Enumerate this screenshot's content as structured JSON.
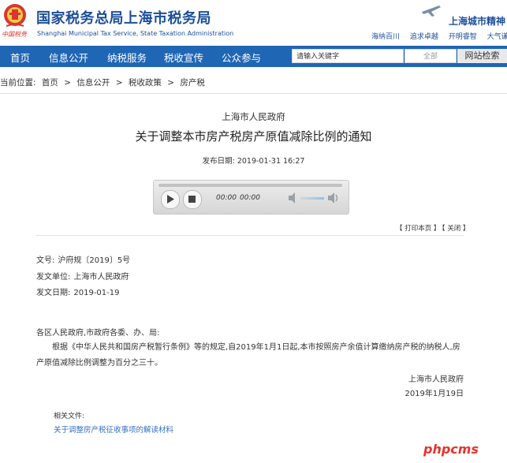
{
  "header": {
    "emblem_text": "中国税务",
    "title_cn": "国家税务总局上海市税务局",
    "title_en": "Shanghai Municipal Tax Service, State Taxation Administration",
    "city_spirit": "上海城市精神",
    "mottos": [
      "海纳百川",
      "追求卓越",
      "开明睿智",
      "大气谦和"
    ]
  },
  "nav": {
    "items": [
      "首页",
      "信息公开",
      "纳税服务",
      "税收宣传",
      "公众参与"
    ]
  },
  "search": {
    "placeholder": "请输入关键字",
    "scope": "全部",
    "button": "网站检索"
  },
  "breadcrumb": {
    "prefix": "当前位置:",
    "items": [
      "首页",
      "信息公开",
      "税收政策",
      "房产税"
    ],
    "separator": ">"
  },
  "article": {
    "issuer": "上海市人民政府",
    "title": "关于调整本市房产税房产原值减除比例的通知",
    "publish_label": "发布日期:",
    "publish_date": "2019-01-31 16:27"
  },
  "player": {
    "current_time": "00:00",
    "total_time": "00:00"
  },
  "tools": {
    "print": "【 打印本页 】",
    "close": "【 关闭 】"
  },
  "meta": {
    "doc_no_label": "文号:",
    "doc_no": "沪府规〔2019〕5号",
    "org_label": "发文单位:",
    "org": "上海市人民政府",
    "date_label": "发文日期:",
    "date": "2019-01-19"
  },
  "body": {
    "salutation": "各区人民政府,市政府各委、办、局:",
    "paragraph": "根据《中华人民共和国房产税暂行条例》等的规定,自2019年1月1日起,本市按照房产余值计算缴纳房产税的纳税人,房产原值减除比例调整为百分之三十。",
    "signature_org": "上海市人民政府",
    "signature_date": "2019年1月19日"
  },
  "related": {
    "label": "相关文件:",
    "link": "关于调整房产税征收事项的解读材料"
  },
  "watermark": "phpcms",
  "colors": {
    "brand_blue": "#1c4f9b",
    "nav_blue": "#1f66b4",
    "link_blue": "#3470c2",
    "watermark_red": "#e8322e"
  }
}
